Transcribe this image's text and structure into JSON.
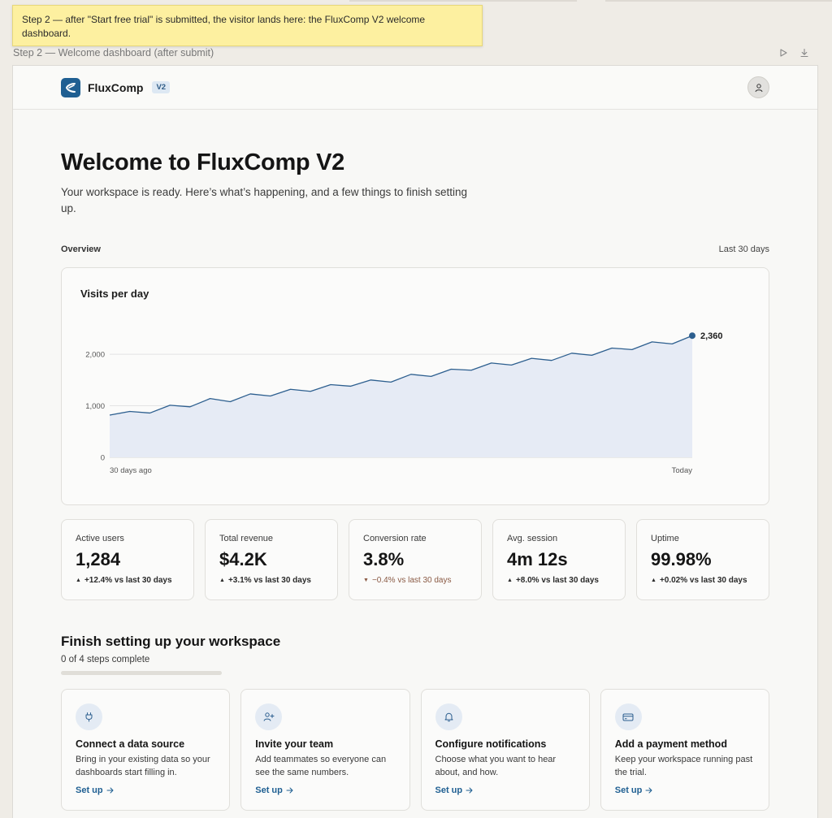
{
  "annotation": {
    "note": "Step 2 — after \"Start free trial\" is submitted, the visitor lands here: the FluxComp V2 welcome dashboard.",
    "frame_label": "Step 2 — Welcome dashboard (after submit)"
  },
  "app": {
    "brand": "FluxComp",
    "version_badge": "V2"
  },
  "hero": {
    "title": "Welcome to FluxComp V2",
    "subtitle": "Your workspace is ready. Here’s what’s happening, and a few things to finish setting up."
  },
  "overview": {
    "label": "Overview",
    "range": "Last 30 days"
  },
  "chart_data": {
    "type": "area",
    "title": "Visits per day",
    "x_start_label": "30 days ago",
    "x_end_label": "Today",
    "yticks": [
      "0",
      "1,000",
      "2,000"
    ],
    "ylim": [
      0,
      2600
    ],
    "values": [
      820,
      890,
      860,
      1010,
      980,
      1140,
      1080,
      1230,
      1190,
      1320,
      1280,
      1410,
      1380,
      1500,
      1460,
      1610,
      1570,
      1710,
      1690,
      1830,
      1790,
      1920,
      1880,
      2020,
      1980,
      2120,
      2090,
      2240,
      2200,
      2360
    ],
    "last_label": "2,360",
    "colors": {
      "line": "#2d5f8f",
      "fill": "#e6ebf5",
      "grid": "#e3e3e3"
    }
  },
  "stats": [
    {
      "label": "Active users",
      "value": "1,284",
      "delta": "+12.4% vs last 30 days",
      "direction": "up"
    },
    {
      "label": "Total revenue",
      "value": "$4.2K",
      "delta": "+3.1% vs last 30 days",
      "direction": "up"
    },
    {
      "label": "Conversion rate",
      "value": "3.8%",
      "delta": "−0.4% vs last 30 days",
      "direction": "down"
    },
    {
      "label": "Avg. session",
      "value": "4m 12s",
      "delta": "+8.0% vs last 30 days",
      "direction": "up"
    },
    {
      "label": "Uptime",
      "value": "99.98%",
      "delta": "+0.02% vs last 30 days",
      "direction": "up"
    }
  ],
  "setup": {
    "title": "Finish setting up your workspace",
    "progress_text": "0 of 4 steps complete",
    "progress_fraction": 0,
    "steps": [
      {
        "icon": "plug-icon",
        "title": "Connect a data source",
        "desc": "Bring in your existing data so your dashboards start filling in.",
        "link": "Set up"
      },
      {
        "icon": "user-plus-icon",
        "title": "Invite your team",
        "desc": "Add teammates so everyone can see the same numbers.",
        "link": "Set up"
      },
      {
        "icon": "bell-icon",
        "title": "Configure notifications",
        "desc": "Choose what you want to hear about, and how.",
        "link": "Set up"
      },
      {
        "icon": "credit-card-icon",
        "title": "Add a payment method",
        "desc": "Keep your workspace running past the trial.",
        "link": "Set up"
      }
    ]
  }
}
